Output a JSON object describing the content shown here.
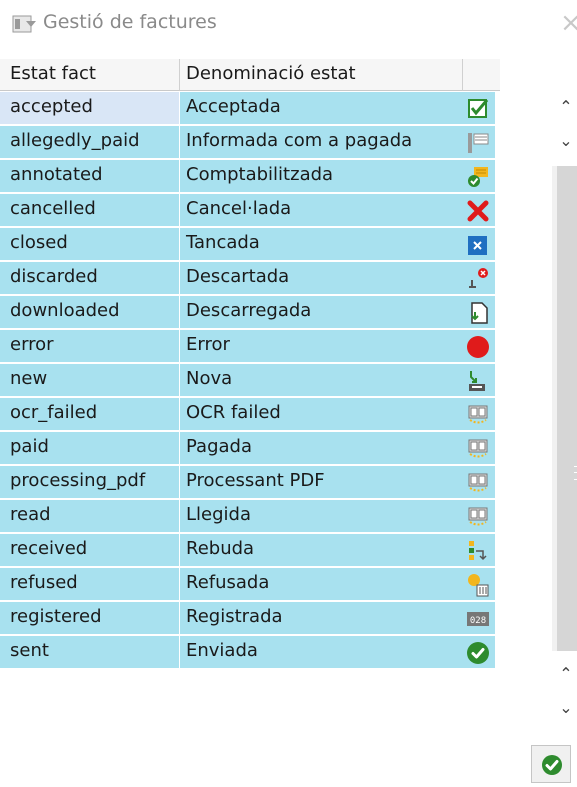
{
  "window": {
    "title": "Gestió de factures"
  },
  "table": {
    "headers": {
      "status": "Estat fact",
      "name": "Denominació estat"
    },
    "rows": [
      {
        "status": "accepted",
        "name": "Acceptada",
        "icon": "accepted-check-icon"
      },
      {
        "status": "allegedly_paid",
        "name": "Informada com a pagada",
        "icon": "reported-paid-icon"
      },
      {
        "status": "annotated",
        "name": "Comptabilitzada",
        "icon": "posted-icon"
      },
      {
        "status": "cancelled",
        "name": "Cancel·lada",
        "icon": "red-x-icon"
      },
      {
        "status": "closed",
        "name": "Tancada",
        "icon": "closed-box-icon"
      },
      {
        "status": "discarded",
        "name": "Descartada",
        "icon": "discarded-icon"
      },
      {
        "status": "downloaded",
        "name": "Descarregada",
        "icon": "download-document-icon"
      },
      {
        "status": "error",
        "name": "Error",
        "icon": "red-circle-icon"
      },
      {
        "status": "new",
        "name": "Nova",
        "icon": "new-inbox-icon"
      },
      {
        "status": "ocr_failed",
        "name": "OCR failed",
        "icon": "ocr-icon"
      },
      {
        "status": "paid",
        "name": "Pagada",
        "icon": "ocr-icon"
      },
      {
        "status": "processing_pdf",
        "name": "Processant PDF",
        "icon": "ocr-icon"
      },
      {
        "status": "read",
        "name": "Llegida",
        "icon": "ocr-icon"
      },
      {
        "status": "received",
        "name": "Rebuda",
        "icon": "received-hierarchy-icon"
      },
      {
        "status": "refused",
        "name": "Refusada",
        "icon": "refused-trash-icon"
      },
      {
        "status": "registered",
        "name": "Registrada",
        "icon": "registered-counter-icon"
      },
      {
        "status": "sent",
        "name": "Enviada",
        "icon": "green-check-circle-icon"
      }
    ]
  },
  "colors": {
    "row_bg": "#a8e1ef",
    "selected_bg": "#d9e6f6",
    "header_bg": "#f6f6f6"
  }
}
